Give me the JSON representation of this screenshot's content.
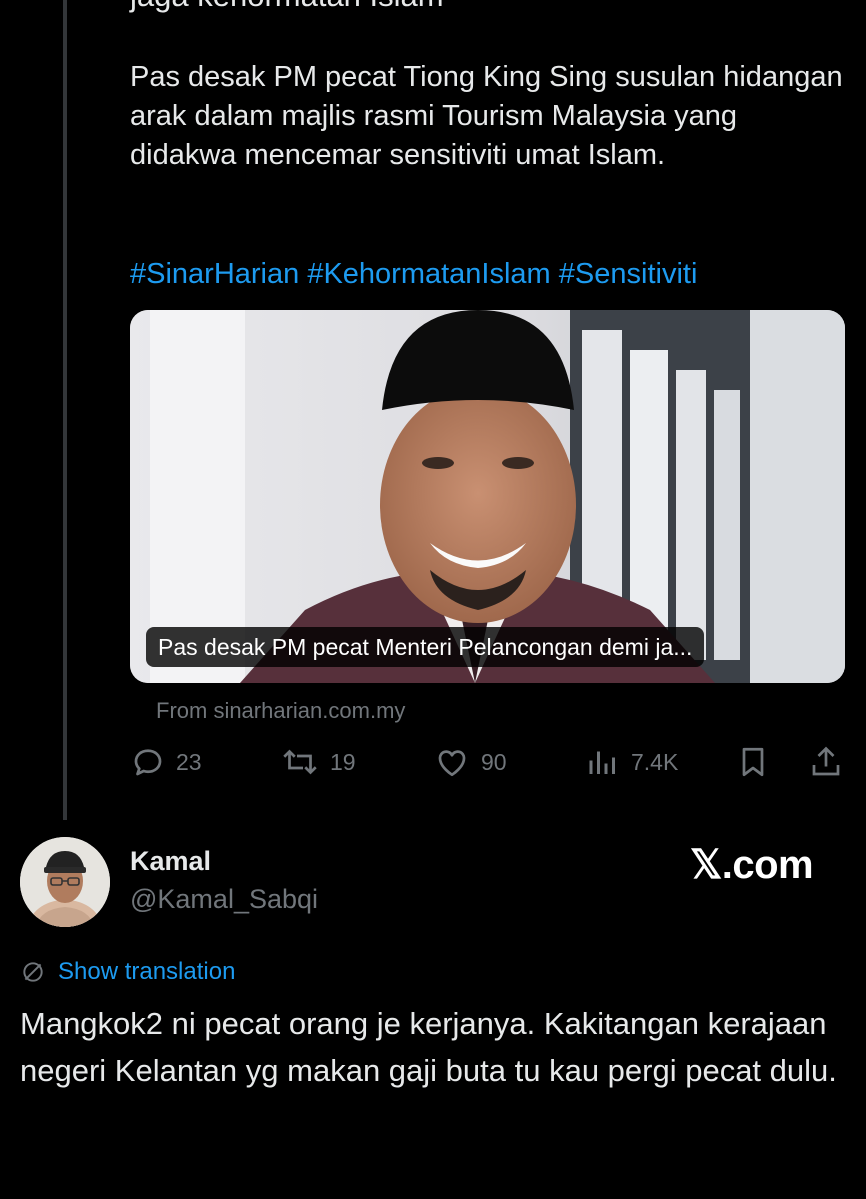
{
  "quoted_tweet": {
    "cut_text": "jaga kehormatan Islam",
    "body": "Pas desak PM pecat Tiong King Sing susulan hidangan arak dalam majlis rasmi Tourism Malaysia yang didakwa mencemar sensitiviti umat Islam.",
    "hashtags": "#SinarHarian #KehormatanIslam #Sensitiviti",
    "card": {
      "caption": "Pas desak PM pecat Menteri Pelancongan demi ja...",
      "source": "From sinarharian.com.my"
    },
    "actions": {
      "replies": "23",
      "retweets": "19",
      "likes": "90",
      "views": "7.4K"
    },
    "icons": [
      "reply-icon",
      "retweet-icon",
      "like-icon",
      "views-icon",
      "bookmark-icon",
      "share-icon"
    ]
  },
  "reply": {
    "display_name": "Kamal",
    "handle": "@Kamal_Sabqi",
    "show_translation": "Show translation",
    "text": "Mangkok2 ni pecat orang je kerjanya. Kakitangan kerajaan negeri Kelantan yg makan gaji buta tu kau pergi pecat dulu."
  },
  "brand": "𝕏.com",
  "colors": {
    "background": "#000000",
    "text": "#e7e9ea",
    "muted": "#71767b",
    "link": "#1d9bf0",
    "thread_line": "#333639"
  }
}
